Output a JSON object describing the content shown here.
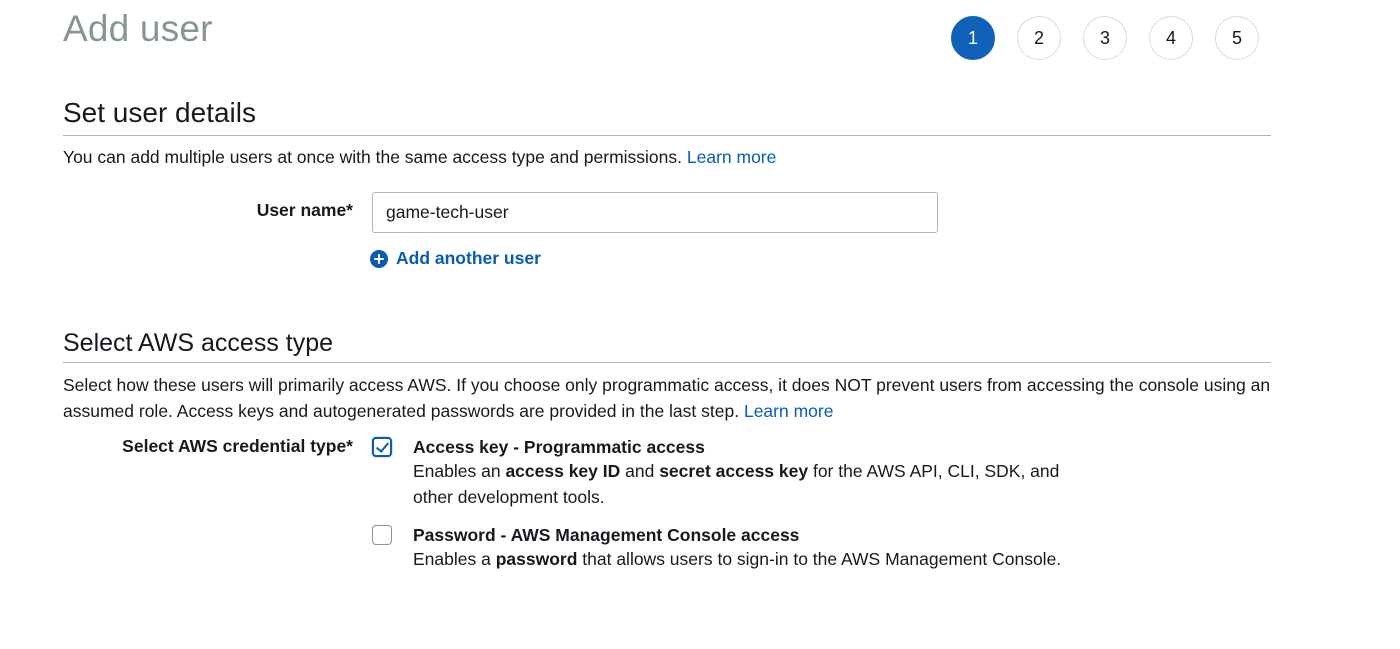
{
  "page": {
    "title": "Add user"
  },
  "stepper": {
    "steps": [
      "1",
      "2",
      "3",
      "4",
      "5"
    ],
    "active": "1"
  },
  "user_details": {
    "heading": "Set user details",
    "description": "You can add multiple users at once with the same access type and permissions.",
    "learn_more": "Learn more",
    "user_name_label": "User name*",
    "user_name_value": "game-tech-user",
    "add_another_user": "Add another user"
  },
  "access_type": {
    "heading": "Select AWS access type",
    "description": "Select how these users will primarily access AWS. If you choose only programmatic access, it does NOT prevent users from accessing the console using an assumed role. Access keys and autogenerated passwords are provided in the last step.",
    "learn_more": "Learn more",
    "credential_label": "Select AWS credential type*",
    "options": [
      {
        "title": "Access key - Programmatic access",
        "checked": true,
        "desc_parts": [
          "Enables an ",
          "access key ID",
          " and ",
          "secret access key",
          " for the AWS API, CLI, SDK, and other development tools."
        ]
      },
      {
        "title": "Password - AWS Management Console access",
        "checked": false,
        "desc_parts": [
          "Enables a ",
          "password",
          " that allows users to sign-in to the AWS Management Console."
        ]
      }
    ]
  },
  "colors": {
    "accent": "#0b5bb5",
    "step_active": "#0f62b8",
    "title_gray": "#879596"
  },
  "icons": {
    "add_user": "plus-circle-icon",
    "checkbox_checked": "check-icon"
  }
}
